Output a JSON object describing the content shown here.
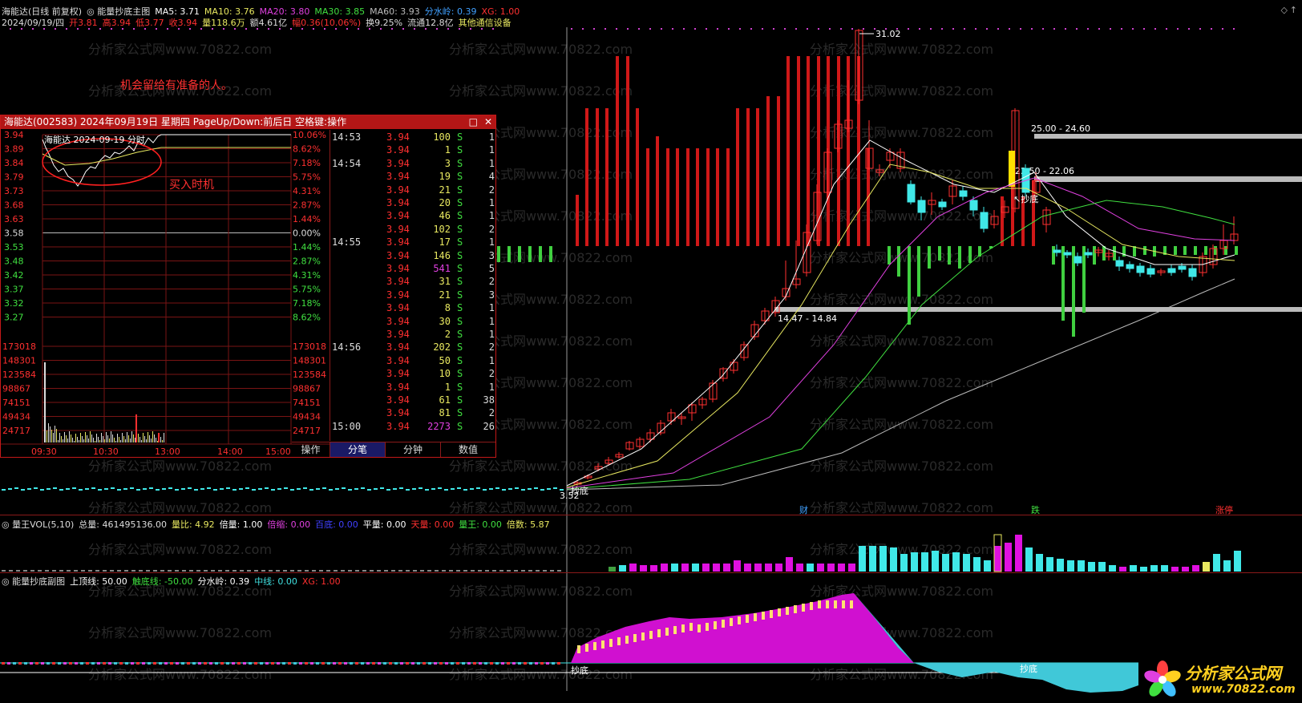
{
  "header": {
    "line1": [
      {
        "text": "海能达(日线 前复权)",
        "color": "#dddddd"
      },
      {
        "text": "◎ 能量抄底主图",
        "color": "#dddddd"
      },
      {
        "text": "MA5: 3.71",
        "color": "#ffffff"
      },
      {
        "text": "MA10: 3.76",
        "color": "#e8e860"
      },
      {
        "text": "MA20: 3.80",
        "color": "#e040e0"
      },
      {
        "text": "MA30: 3.85",
        "color": "#40e040"
      },
      {
        "text": "MA60: 3.93",
        "color": "#bbbbbb"
      },
      {
        "text": "分水岭: 0.39",
        "color": "#40a0ff"
      },
      {
        "text": "XG: 1.00",
        "color": "#ff3030"
      }
    ],
    "line2": [
      {
        "text": "2024/09/19/四",
        "color": "#dddddd"
      },
      {
        "text": "开3.81",
        "color": "#ff3030"
      },
      {
        "text": "高3.94",
        "color": "#ff3030"
      },
      {
        "text": "低3.77",
        "color": "#ff3030"
      },
      {
        "text": "收3.94",
        "color": "#ff3030"
      },
      {
        "text": "量118.6万",
        "color": "#e8e860"
      },
      {
        "text": "额4.61亿",
        "color": "#dddddd"
      },
      {
        "text": "幅0.36(10.06%)",
        "color": "#ff3030"
      },
      {
        "text": "换9.25%",
        "color": "#dddddd"
      },
      {
        "text": "流通12.8亿",
        "color": "#dddddd"
      },
      {
        "text": "其他通信设备",
        "color": "#e8e860"
      }
    ],
    "right_icons": [
      "diamond-icon",
      "up-arrow-icon"
    ]
  },
  "slogan": "机会留给有准备的人。",
  "popup": {
    "title": "海能达(002583) 2024年09月19日 星期四 PageUp/Down:前后日 空格键:操作",
    "chart_title": "海能达   2024-09-19 分时",
    "annotation": "买入时机",
    "price_ticks": [
      "3.94",
      "3.89",
      "3.84",
      "3.79",
      "3.73",
      "3.68",
      "3.63",
      "3.58",
      "3.53",
      "3.48",
      "3.42",
      "3.37",
      "3.32",
      "3.27"
    ],
    "pct_ticks": [
      "10.06%",
      "8.62%",
      "7.18%",
      "5.75%",
      "4.31%",
      "2.87%",
      "1.44%",
      "0.00%",
      "1.44%",
      "2.87%",
      "4.31%",
      "5.75%",
      "7.18%",
      "8.62%"
    ],
    "vol_ticks": [
      "173018",
      "148301",
      "123584",
      "98867",
      "74151",
      "49434",
      "24717"
    ],
    "time_labels": [
      "09:30",
      "10:30",
      "13:00",
      "14:00",
      "15:00"
    ],
    "op_label": "操作",
    "tabs": [
      "分笔",
      "分钟",
      "数值"
    ],
    "ticks": [
      {
        "time": "14:53",
        "price": "3.94",
        "vol": "100",
        "side": "S",
        "n": "1"
      },
      {
        "time": "",
        "price": "3.94",
        "vol": "1",
        "side": "S",
        "n": "1"
      },
      {
        "time": "14:54",
        "price": "3.94",
        "vol": "3",
        "side": "S",
        "n": "1"
      },
      {
        "time": "",
        "price": "3.94",
        "vol": "19",
        "side": "S",
        "n": "4"
      },
      {
        "time": "",
        "price": "3.94",
        "vol": "21",
        "side": "S",
        "n": "2"
      },
      {
        "time": "",
        "price": "3.94",
        "vol": "20",
        "side": "S",
        "n": "1"
      },
      {
        "time": "",
        "price": "3.94",
        "vol": "46",
        "side": "S",
        "n": "1"
      },
      {
        "time": "",
        "price": "3.94",
        "vol": "102",
        "side": "S",
        "n": "2"
      },
      {
        "time": "14:55",
        "price": "3.94",
        "vol": "17",
        "side": "S",
        "n": "1"
      },
      {
        "time": "",
        "price": "3.94",
        "vol": "146",
        "side": "S",
        "n": "3"
      },
      {
        "time": "",
        "price": "3.94",
        "vol": "541",
        "side": "S",
        "n": "5"
      },
      {
        "time": "",
        "price": "3.94",
        "vol": "31",
        "side": "S",
        "n": "2"
      },
      {
        "time": "",
        "price": "3.94",
        "vol": "21",
        "side": "S",
        "n": "3"
      },
      {
        "time": "",
        "price": "3.94",
        "vol": "8",
        "side": "S",
        "n": "1"
      },
      {
        "time": "",
        "price": "3.94",
        "vol": "30",
        "side": "S",
        "n": "1"
      },
      {
        "time": "",
        "price": "3.94",
        "vol": "2",
        "side": "S",
        "n": "1"
      },
      {
        "time": "14:56",
        "price": "3.94",
        "vol": "202",
        "side": "S",
        "n": "2"
      },
      {
        "time": "",
        "price": "3.94",
        "vol": "50",
        "side": "S",
        "n": "1"
      },
      {
        "time": "",
        "price": "3.94",
        "vol": "10",
        "side": "S",
        "n": "2"
      },
      {
        "time": "",
        "price": "3.94",
        "vol": "1",
        "side": "S",
        "n": "1"
      },
      {
        "time": "",
        "price": "3.94",
        "vol": "61",
        "side": "S",
        "n": "38"
      },
      {
        "time": "",
        "price": "3.94",
        "vol": "81",
        "side": "S",
        "n": "2"
      },
      {
        "time": "15:00",
        "price": "3.94",
        "vol": "2273",
        "side": "S",
        "n": "26"
      }
    ]
  },
  "main_chart": {
    "high_label": "31.02",
    "low_label": "3.52",
    "zones": [
      "25.00 - 24.60",
      "22.50 - 22.06",
      "14.47 - 14.84"
    ],
    "signal_label": "抄底",
    "event_labels": [
      "财",
      "跌",
      "涨停"
    ]
  },
  "vol_panel": {
    "items": [
      {
        "text": "◎ 量王VOL(5,10)",
        "color": "#dddddd"
      },
      {
        "text": "总量: 461495136.00",
        "color": "#dddddd"
      },
      {
        "text": "量比: 4.92",
        "color": "#e8e860"
      },
      {
        "text": "倍量: 1.00",
        "color": "#ffffff"
      },
      {
        "text": "倍缩: 0.00",
        "color": "#e040e0"
      },
      {
        "text": "百底: 0.00",
        "color": "#4040ff"
      },
      {
        "text": "平量: 0.00",
        "color": "#ffffff"
      },
      {
        "text": "天量: 0.00",
        "color": "#ff3030"
      },
      {
        "text": "量王: 0.00",
        "color": "#40e040"
      },
      {
        "text": "倍数: 5.87",
        "color": "#e8e860"
      }
    ]
  },
  "energy_panel": {
    "items": [
      {
        "text": "◎ 能量抄底副图",
        "color": "#dddddd"
      },
      {
        "text": "上顶线: 50.00",
        "color": "#ffffff"
      },
      {
        "text": "触底线: -50.00",
        "color": "#40e040"
      },
      {
        "text": "分水岭: 0.39",
        "color": "#ffffff"
      },
      {
        "text": "中线: 0.00",
        "color": "#40e0e0"
      },
      {
        "text": "XG: 1.00",
        "color": "#ff3030"
      }
    ],
    "signal_label": "抄底"
  },
  "watermark": "分析家公式网www.70822.com",
  "logo": {
    "name": "分析家公式网",
    "url": "www.70822.com"
  },
  "colors": {
    "up": "#ff3030",
    "down": "#40e8e8",
    "ma5": "#ffffff",
    "ma10": "#e8e860",
    "ma20": "#e040e0",
    "ma30": "#40e040",
    "ma60": "#bbbbbb",
    "energy": "#d010d0"
  }
}
